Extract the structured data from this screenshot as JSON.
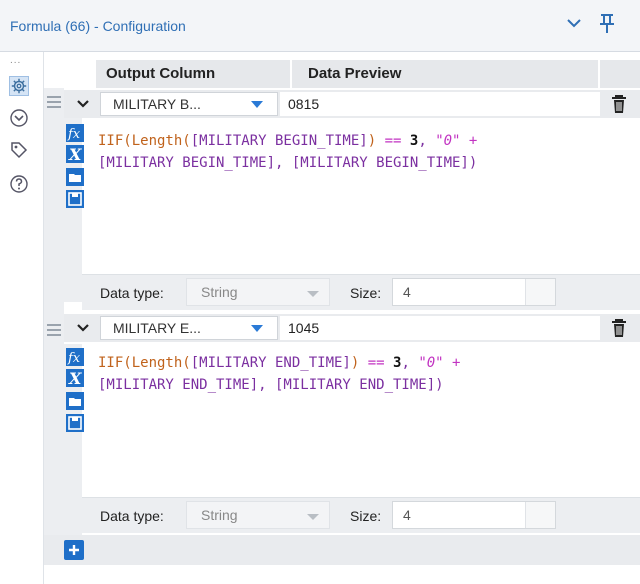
{
  "window": {
    "title": "Formula (66) - Configuration"
  },
  "header": {
    "output_column": "Output Column",
    "data_preview": "Data Preview"
  },
  "formulas": [
    {
      "column": "MILITARY B...",
      "preview": "0815",
      "expr": {
        "fn": "IIF(Length(",
        "field1": "[MILITARY BEGIN_TIME]",
        "p1": ")",
        "eq": " == ",
        "num": "3",
        "comma1": ", ",
        "str": "\"0\"",
        "plus": " +",
        "line2": "[MILITARY BEGIN_TIME], [MILITARY BEGIN_TIME])"
      },
      "data_type_label": "Data type:",
      "data_type": "String",
      "size_label": "Size:",
      "size": "4"
    },
    {
      "column": "MILITARY E...",
      "preview": "1045",
      "expr": {
        "fn": "IIF(Length(",
        "field1": "[MILITARY END_TIME]",
        "p1": ")",
        "eq": " == ",
        "num": "3",
        "comma1": ", ",
        "str": "\"0\"",
        "plus": " +",
        "line2": "[MILITARY END_TIME], [MILITARY END_TIME])"
      },
      "data_type_label": "Data type:",
      "data_type": "String",
      "size_label": "Size:",
      "size": "4"
    }
  ],
  "sidebar": {
    "dots": "...",
    "icons": [
      "gear-icon",
      "workflow-icon",
      "tag-icon",
      "help-icon"
    ]
  },
  "colors": {
    "accent": "#2f6fb5",
    "button": "#1f6fc8",
    "field": "#7b2fa0",
    "function": "#c0621b"
  }
}
